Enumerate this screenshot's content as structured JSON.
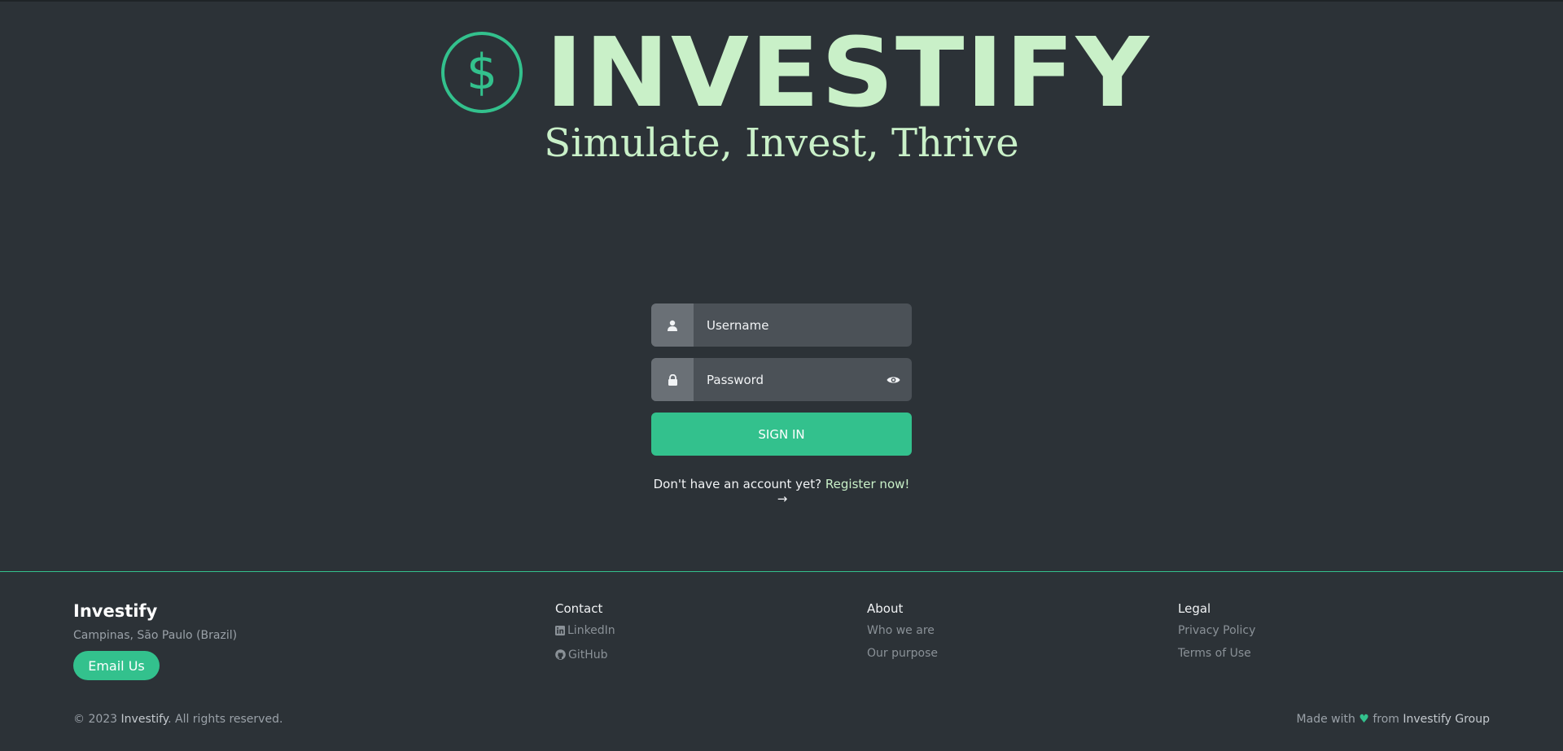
{
  "header": {
    "logo_symbol": "$",
    "brand_name": "INVESTIFY",
    "tagline": "Simulate, Invest, Thrive"
  },
  "login": {
    "username_placeholder": "Username",
    "password_placeholder": "Password",
    "signin_label": "SIGN IN",
    "register_prompt": "Don't have an account yet?",
    "register_link": "Register now!",
    "register_arrow": "→",
    "icons": [
      "user-icon",
      "lock-icon",
      "eye-icon"
    ]
  },
  "footer": {
    "brand": "Investify",
    "location": "Campinas, São Paulo (Brazil)",
    "email_button": "Email Us",
    "contact": {
      "title": "Contact",
      "links": [
        "LinkedIn",
        "GitHub"
      ]
    },
    "about": {
      "title": "About",
      "links": [
        "Who we are",
        "Our purpose"
      ]
    },
    "legal": {
      "title": "Legal",
      "links": [
        "Privacy Policy",
        "Terms of Use"
      ]
    },
    "copyright_prefix": "© 2023",
    "copyright_brand": "Investify",
    "copyright_suffix": ". All rights reserved.",
    "made_with": "Made with",
    "heart": "♥",
    "from": "from",
    "group": "Investify Group"
  },
  "colors": {
    "background": "#2c3237",
    "accent": "#33c18d",
    "brand_light": "#c9f0c8"
  }
}
